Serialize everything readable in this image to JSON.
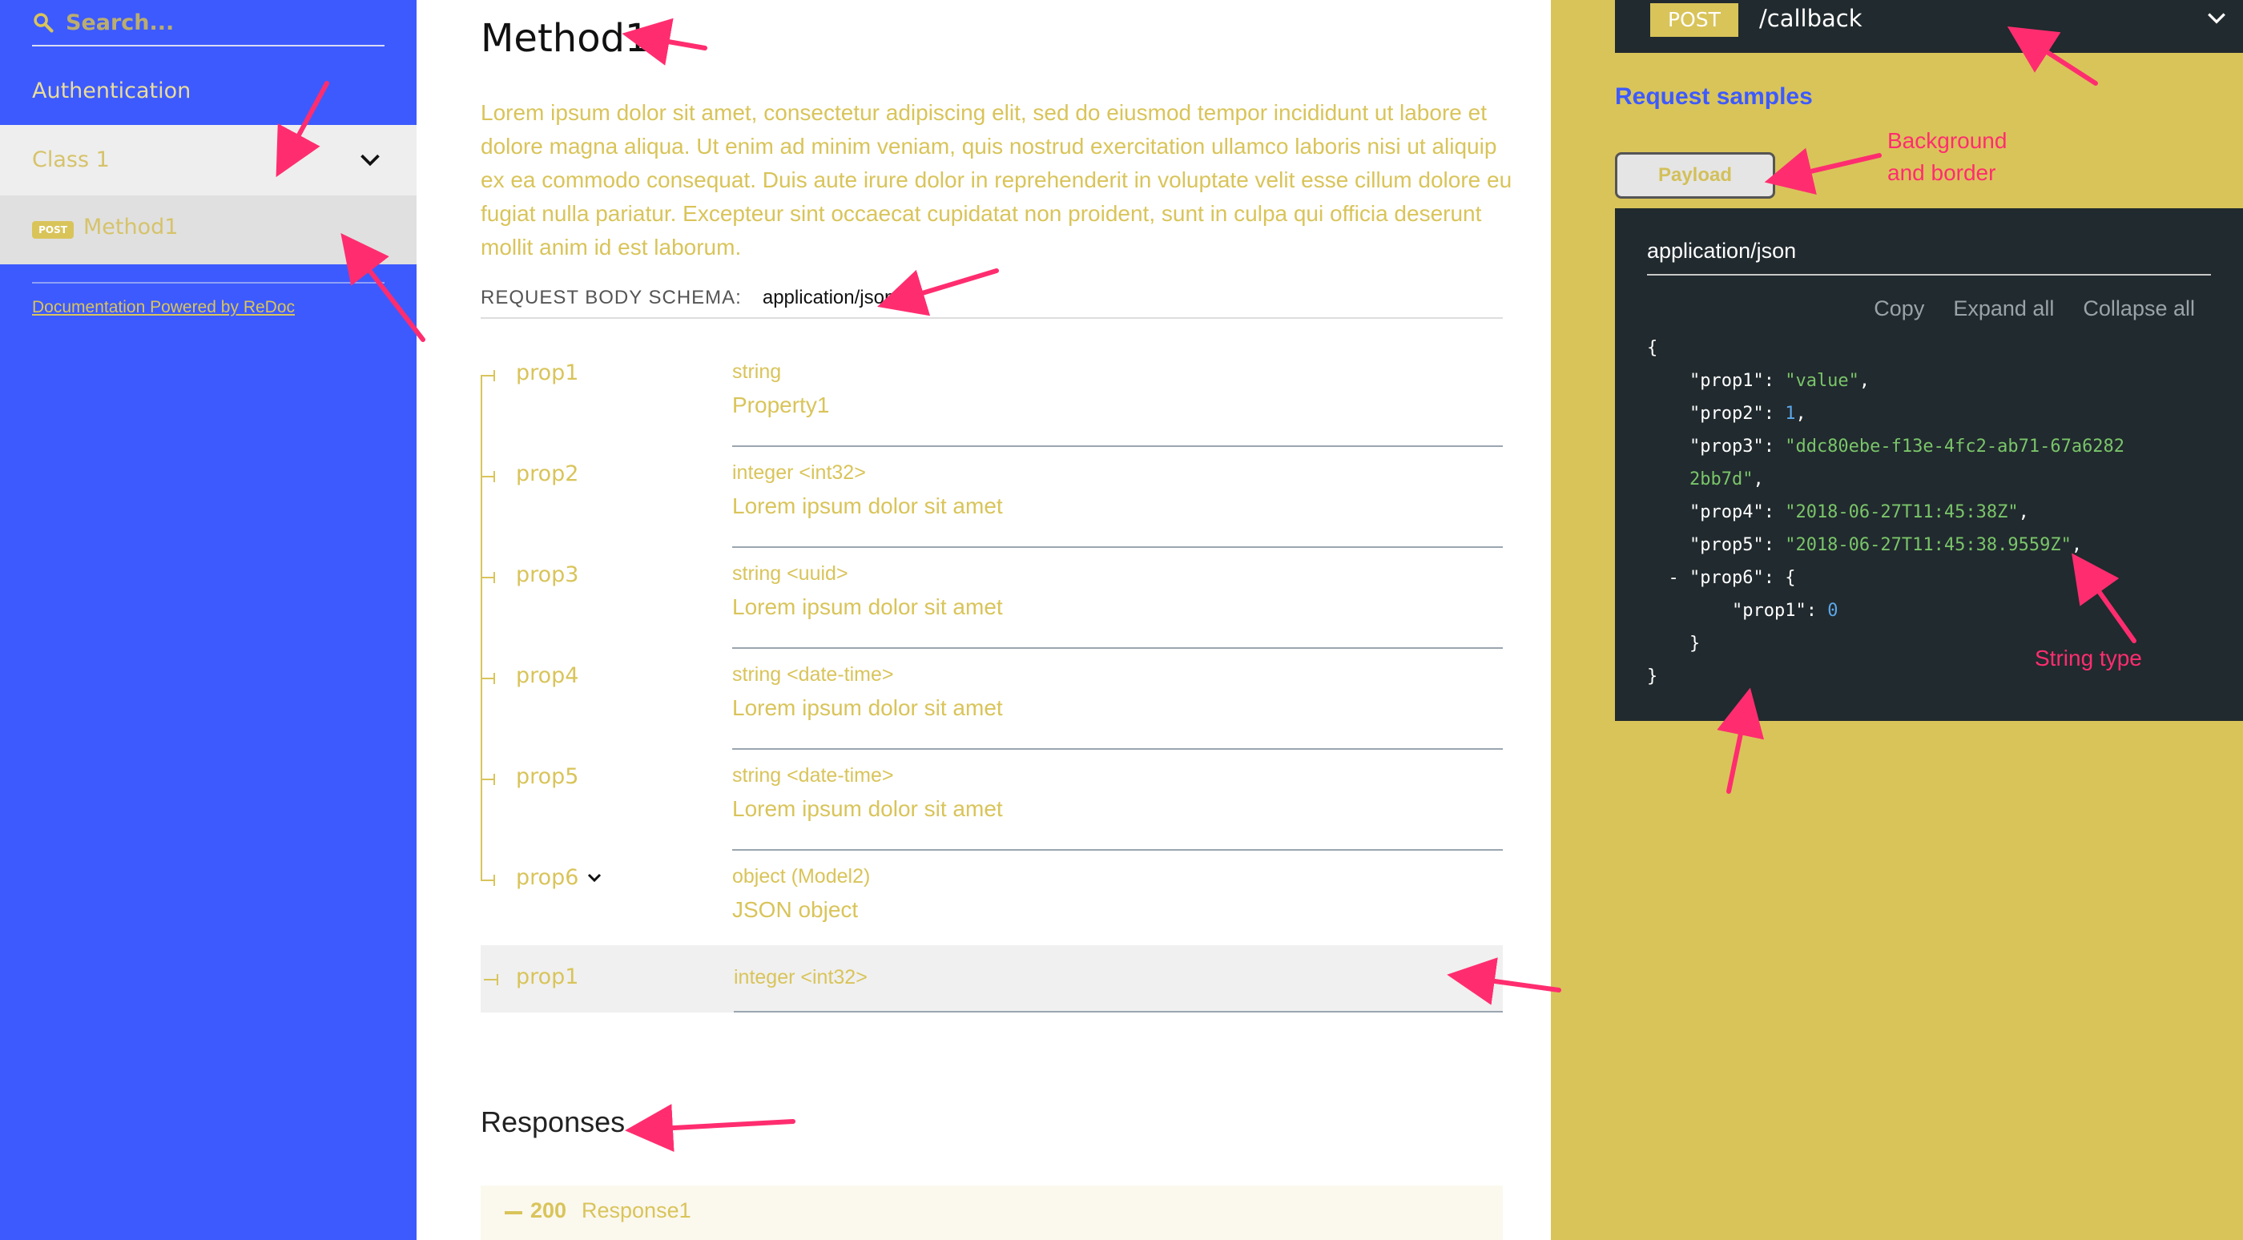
{
  "sidebar": {
    "search_placeholder": "Search...",
    "items": [
      {
        "label": "Authentication"
      },
      {
        "label": "Class 1"
      },
      {
        "label": "Method1",
        "badge": "POST"
      }
    ],
    "powered_by": "Documentation Powered by ReDoc"
  },
  "operation": {
    "title": "Method1",
    "description": "Lorem ipsum dolor sit amet, consectetur adipiscing elit, sed do eiusmod tempor incididunt ut labore et dolore magna aliqua. Ut enim ad minim veniam, quis nostrud exercitation ullamco laboris nisi ut aliquip ex ea commodo consequat. Duis aute irure dolor in reprehenderit in voluptate velit esse cillum dolore eu fugiat nulla pariatur. Excepteur sint occaecat cupidatat non proident, sunt in culpa qui officia deserunt mollit anim id est laborum.",
    "schema_label": "REQUEST BODY SCHEMA:",
    "schema_type": "application/json",
    "props": [
      {
        "name": "prop1",
        "type": "string",
        "desc": "Property1"
      },
      {
        "name": "prop2",
        "type": "integer <int32>",
        "desc": "Lorem ipsum dolor sit amet"
      },
      {
        "name": "prop3",
        "type": "string <uuid>",
        "desc": "Lorem ipsum dolor sit amet"
      },
      {
        "name": "prop4",
        "type": "string <date-time>",
        "desc": "Lorem ipsum dolor sit amet"
      },
      {
        "name": "prop5",
        "type": "string <date-time>",
        "desc": "Lorem ipsum dolor sit amet"
      },
      {
        "name": "prop6",
        "type": "object (Model2)",
        "desc": "JSON object"
      }
    ],
    "nested_prop": {
      "name": "prop1",
      "type": "integer <int32>"
    },
    "responses_title": "Responses",
    "response": {
      "code": "200",
      "name": "Response1"
    }
  },
  "right": {
    "endpoint": {
      "method": "POST",
      "path": "/callback"
    },
    "samples_title": "Request samples",
    "tab": "Payload",
    "content_type": "application/json",
    "actions": {
      "copy": "Copy",
      "expand": "Expand all",
      "collapse": "Collapse all"
    },
    "code": {
      "open": "{",
      "prop1_key": "\"prop1\"",
      "prop1_val": "\"value\"",
      "prop2_key": "\"prop2\"",
      "prop2_val": "1",
      "prop3_key": "\"prop3\"",
      "prop3_val_a": "\"ddc80ebe-f13e-4fc2-ab71-67a6282",
      "prop3_val_b": "2bb7d\"",
      "prop4_key": "\"prop4\"",
      "prop4_val": "\"2018-06-27T11:45:38Z\"",
      "prop5_key": "\"prop5\"",
      "prop5_val": "\"2018-06-27T11:45:38.9559Z\"",
      "prop6_key": "\"prop6\"",
      "nested_key": "\"prop1\"",
      "nested_val": "0",
      "close_inner": "}",
      "close": "}"
    }
  },
  "annotations": {
    "background_border": [
      "Background",
      "and border"
    ],
    "string_type": "String type",
    "color": "#ff2d6f"
  },
  "colors": {
    "sidebar_bg": "#3d5afe",
    "accent": "#d9c45a",
    "code_bg": "#212a2e",
    "link_blue": "#3d5afe"
  }
}
